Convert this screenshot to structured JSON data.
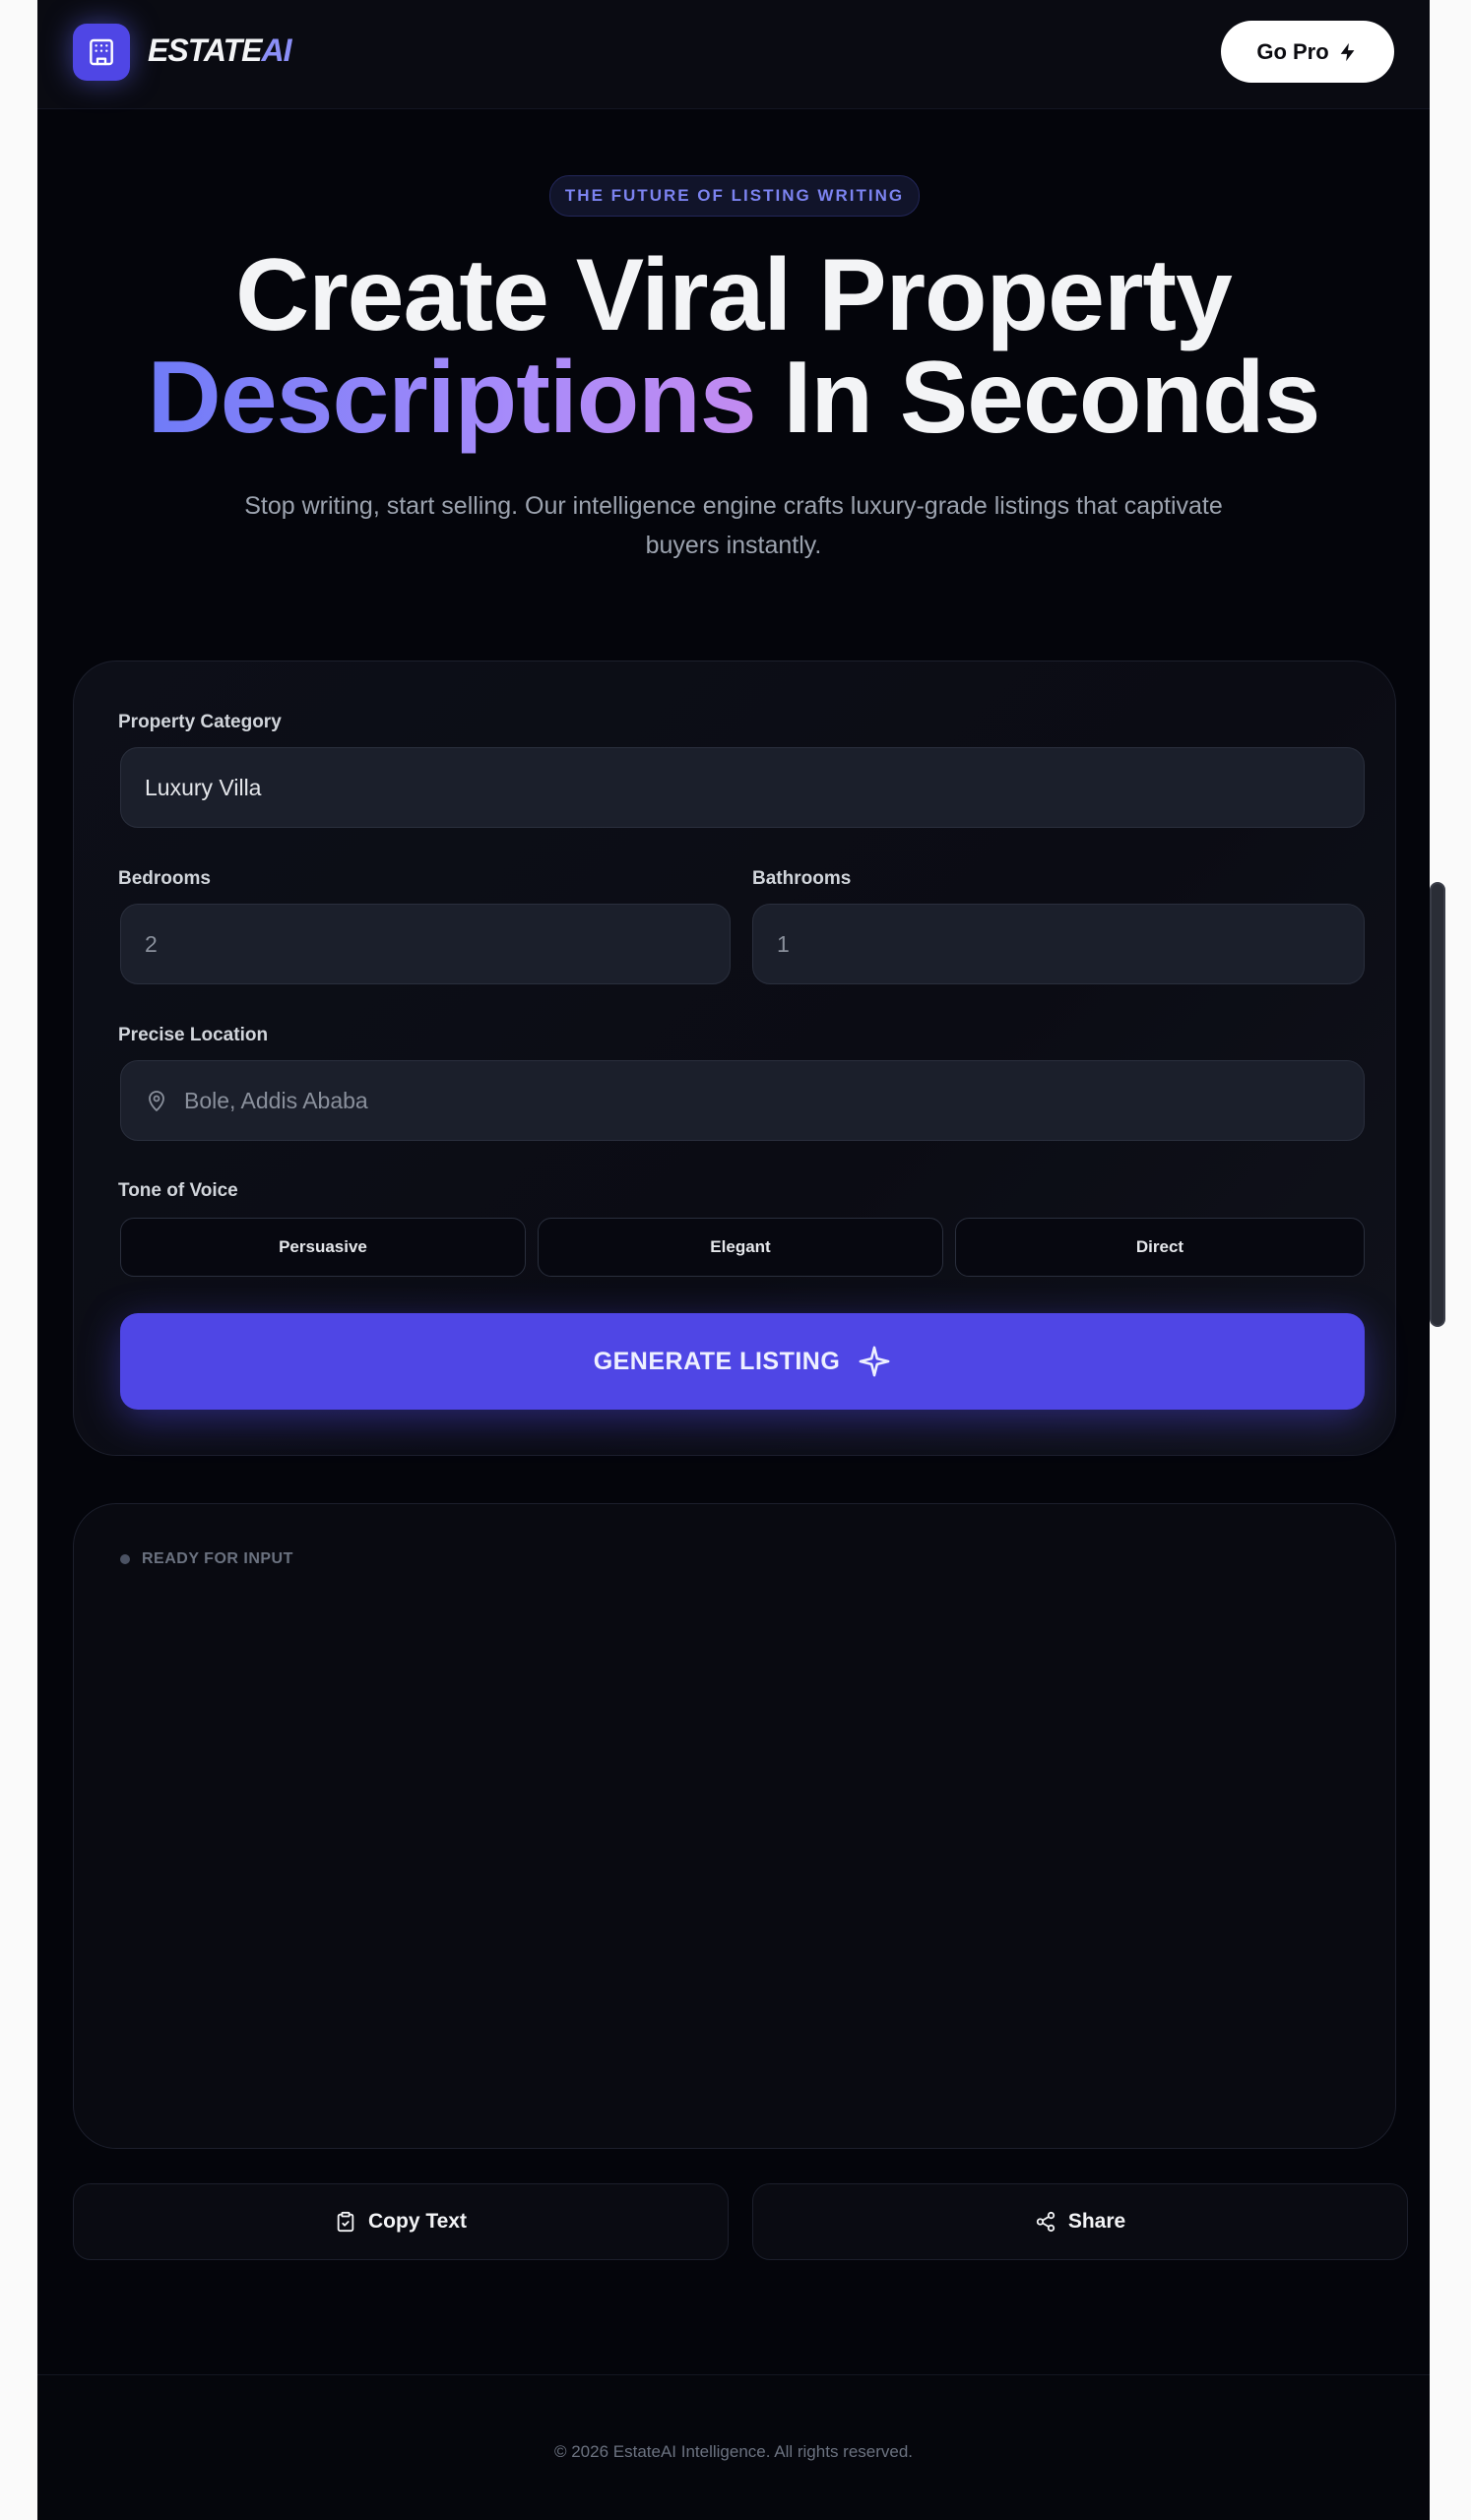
{
  "header": {
    "brand_main": "ESTATE",
    "brand_accent": "AI",
    "go_pro_label": "Go Pro",
    "logo_icon": "building-icon",
    "go_pro_icon": "bolt-icon"
  },
  "hero": {
    "badge": "THE FUTURE OF LISTING WRITING",
    "title_line1": "Create Viral Property",
    "title_highlight": "Descriptions",
    "title_line2_rest": "In Seconds",
    "subtitle": "Stop writing, start selling. Our intelligence engine crafts luxury-grade listings that captivate buyers instantly."
  },
  "form": {
    "category_label": "Property Category",
    "category_value": "Luxury Villa",
    "bedrooms_label": "Bedrooms",
    "bedrooms_value": "2",
    "bathrooms_label": "Bathrooms",
    "bathrooms_value": "1",
    "location_label": "Precise Location",
    "location_placeholder": "Bole, Addis Ababa",
    "tone_label": "Tone of Voice",
    "tones": [
      "Persuasive",
      "Elegant",
      "Direct"
    ],
    "generate_label": "GENERATE LISTING"
  },
  "output": {
    "status": "READY FOR INPUT"
  },
  "actions": {
    "copy_label": "Copy Text",
    "share_label": "Share"
  },
  "footer": {
    "copyright": "© 2026 EstateAI Intelligence. All rights reserved."
  },
  "colors": {
    "accent": "#4f46e5",
    "background": "#04050b",
    "gradient_start": "#6f7bf7",
    "gradient_end": "#c38bf0"
  }
}
